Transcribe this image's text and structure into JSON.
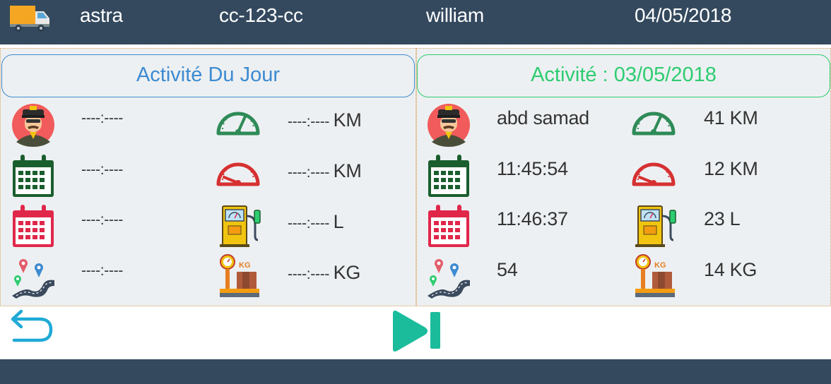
{
  "header": {
    "vehicle": "astra",
    "plate": "cc-123-cc",
    "driver": "william",
    "date": "04/05/2018"
  },
  "today": {
    "title": "Activité Du Jour",
    "driver": "----:----",
    "start_time": "----:----",
    "end_time": "----:----",
    "distance": "----:----",
    "km_start_value": "----:----",
    "km_start_unit": "KM",
    "km_end_value": "----:----",
    "km_end_unit": "KM",
    "fuel_value": "----:----",
    "fuel_unit": "L",
    "weight_value": "----:----",
    "weight_unit": "KG"
  },
  "previous": {
    "title": "Activité : 03/05/2018",
    "driver": "abd samad",
    "start_time": "11:45:54",
    "end_time": "11:46:37",
    "distance": "54",
    "km_start": "41 KM",
    "km_end": "12 KM",
    "fuel": "23 L",
    "weight": "14 KG"
  },
  "icons": {
    "truck": "truck-icon",
    "driver": "taxi-driver-icon",
    "calendar_start": "calendar-green-icon",
    "calendar_end": "calendar-red-icon",
    "route": "road-route-icon",
    "gauge_start": "speedometer-green-icon",
    "gauge_end": "speedometer-red-icon",
    "fuel": "fuel-pump-icon",
    "weight": "scale-kg-icon",
    "back": "back-arrow-icon",
    "next": "skip-next-icon"
  },
  "colors": {
    "header_bg": "#34495e",
    "panel_bg": "#edf0f2",
    "today_accent": "#3d8bd1",
    "previous_accent": "#2ecc71",
    "next_button": "#1abc9c",
    "back_button": "#1fa9d6"
  }
}
